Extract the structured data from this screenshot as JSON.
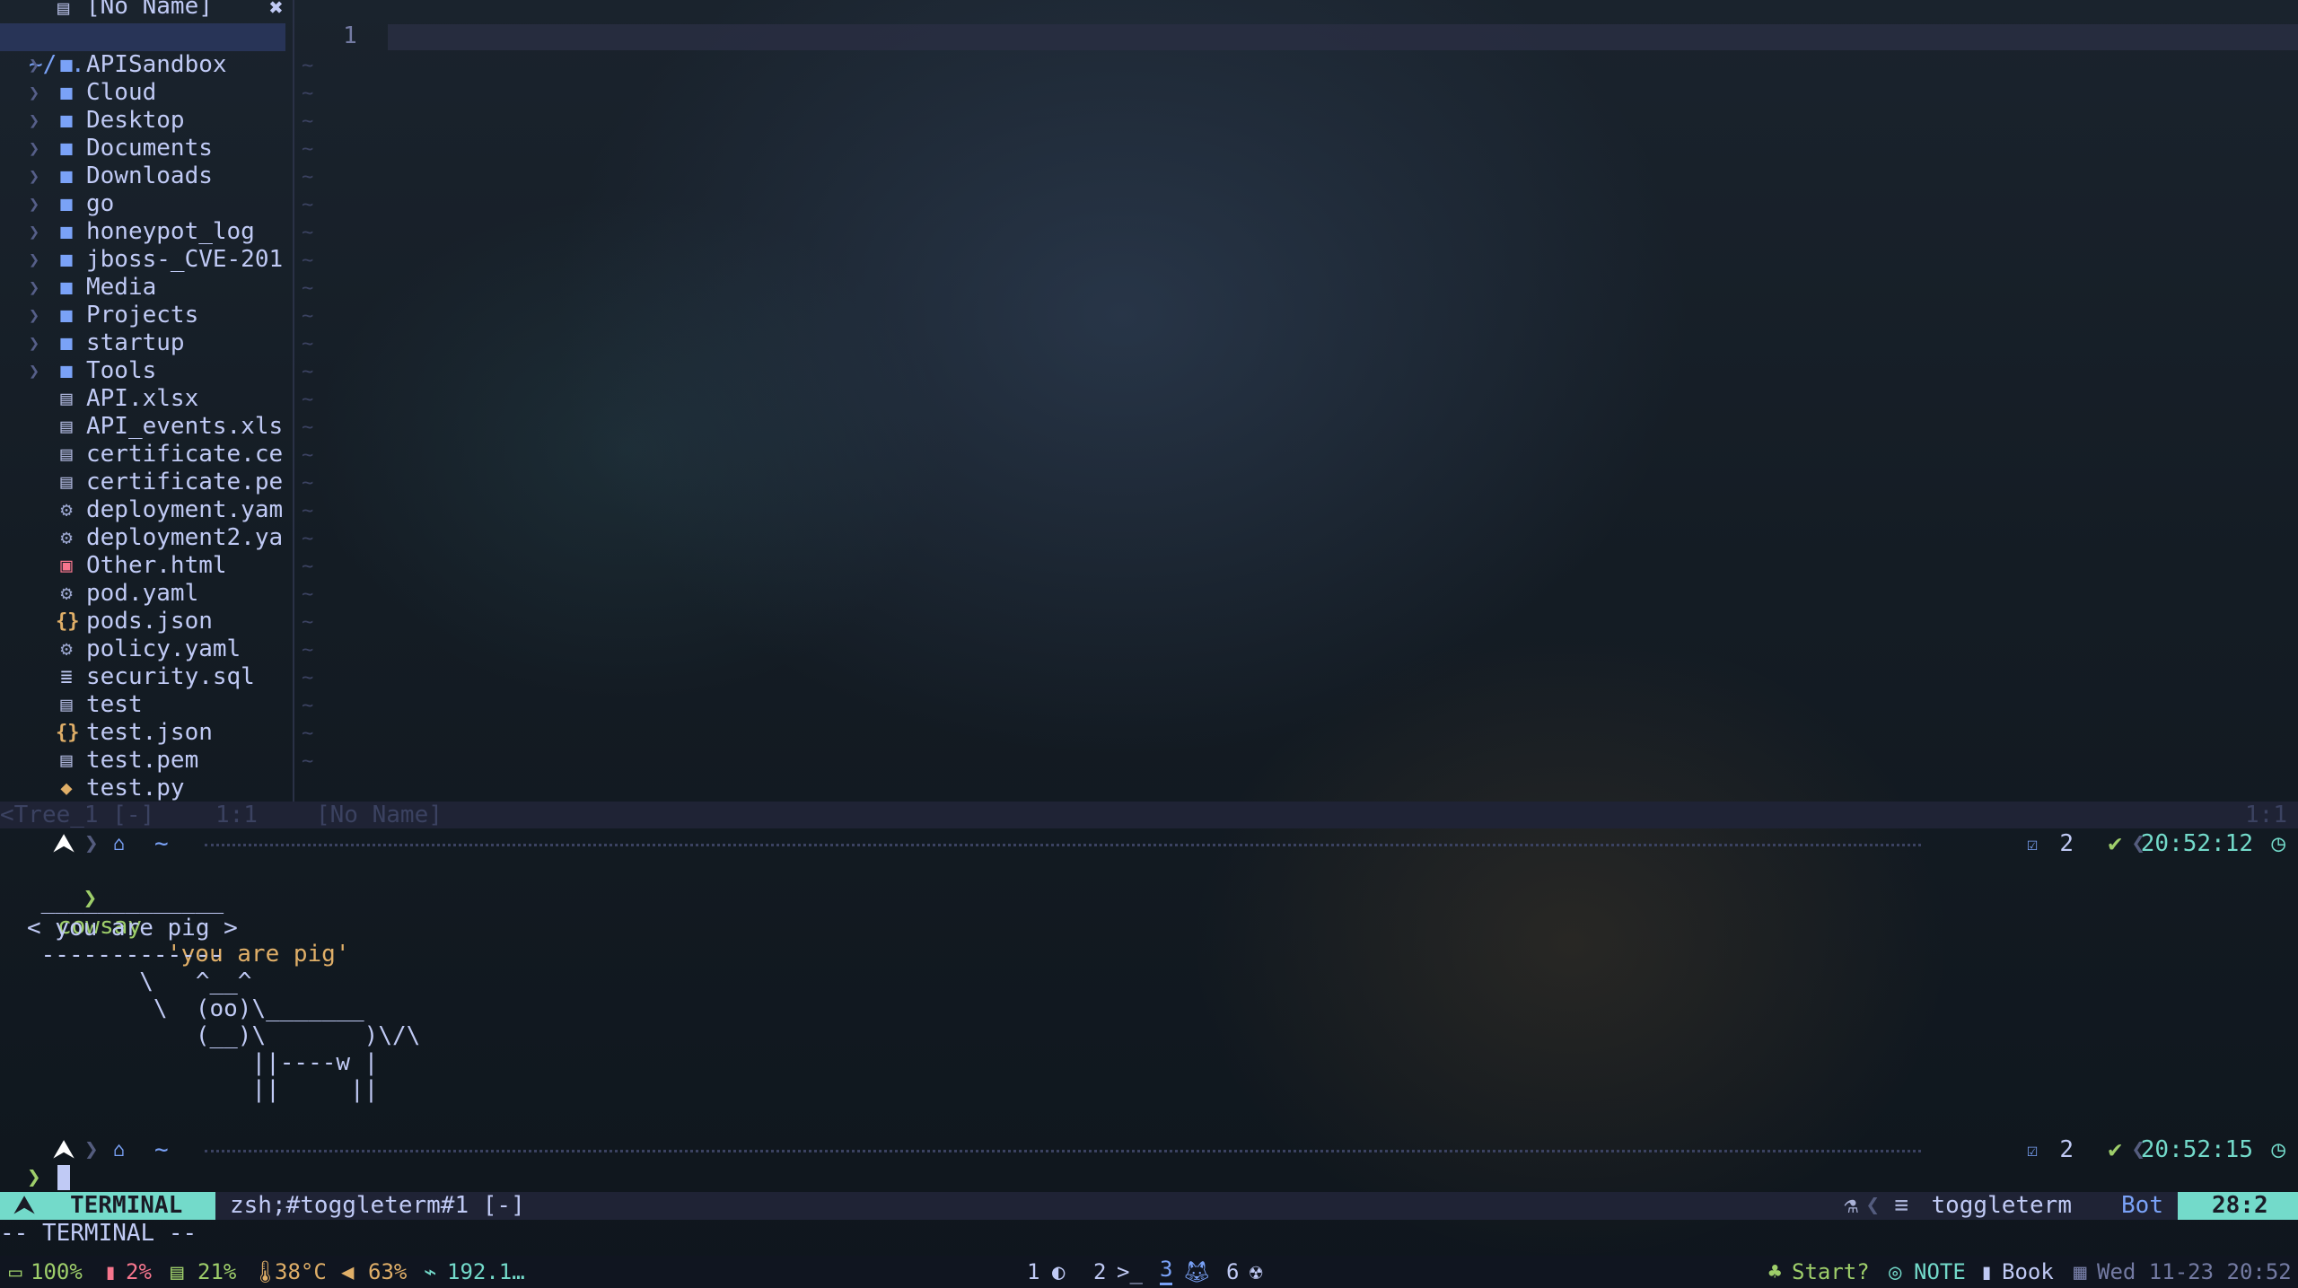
{
  "buffer_tab": {
    "name": "[No Name]",
    "close_icon": "✖"
  },
  "tree": {
    "root": "~/..",
    "items": [
      {
        "name": "APISandbox",
        "type": "folder"
      },
      {
        "name": "Cloud",
        "type": "folder"
      },
      {
        "name": "Desktop",
        "type": "folder"
      },
      {
        "name": "Documents",
        "type": "folder"
      },
      {
        "name": "Downloads",
        "type": "folder"
      },
      {
        "name": "go",
        "type": "folder"
      },
      {
        "name": "honeypot_log",
        "type": "folder"
      },
      {
        "name": "jboss-_CVE-201",
        "type": "folder"
      },
      {
        "name": "Media",
        "type": "folder"
      },
      {
        "name": "Projects",
        "type": "folder"
      },
      {
        "name": "startup",
        "type": "folder"
      },
      {
        "name": "Tools",
        "type": "folder"
      },
      {
        "name": "API.xlsx",
        "type": "file"
      },
      {
        "name": "API_events.xls",
        "type": "file"
      },
      {
        "name": "certificate.ce",
        "type": "file"
      },
      {
        "name": "certificate.pe",
        "type": "file"
      },
      {
        "name": "deployment.yam",
        "type": "gear"
      },
      {
        "name": "deployment2.ya",
        "type": "gear"
      },
      {
        "name": "Other.html",
        "type": "html"
      },
      {
        "name": "pod.yaml",
        "type": "gear"
      },
      {
        "name": "pods.json",
        "type": "json"
      },
      {
        "name": "policy.yaml",
        "type": "gear"
      },
      {
        "name": "security.sql",
        "type": "db"
      },
      {
        "name": "test",
        "type": "file"
      },
      {
        "name": "test.json",
        "type": "json"
      },
      {
        "name": "test.pem",
        "type": "file"
      },
      {
        "name": "test.py",
        "type": "py"
      }
    ]
  },
  "editor": {
    "line_number": "1"
  },
  "split_status": {
    "left": "<Tree_1 [-]",
    "pos": "1:1",
    "buffer": "[No Name]",
    "right": "1:1"
  },
  "prompt1": {
    "arch": "⮝",
    "home": "~",
    "count": "2",
    "time": "20:52:12"
  },
  "prompt2": {
    "arch": "⮝",
    "home": "~",
    "count": "2",
    "time": "20:52:15"
  },
  "command": {
    "prompt": "❯",
    "cmd": "cowsay",
    "arg": "'you are pig'"
  },
  "cow_lines": [
    " _____________",
    "< you are pig >",
    " -------------",
    "        \\   ^__^",
    "         \\  (oo)\\_______",
    "            (__)\\       )\\/\\",
    "                ||----w |",
    "                ||     ||"
  ],
  "input_prompt": "❯",
  "term_status": {
    "mode": "TERMINAL",
    "title": "zsh;#toggleterm#1 [-]",
    "ft": "toggleterm",
    "position": "Bot",
    "cursor": "28:2"
  },
  "mode_line": "-- TERMINAL --",
  "sysbar": {
    "battery": "100%",
    "cpu": "2%",
    "mem": "21%",
    "temp": "38°C",
    "volume": "63%",
    "ip": "192.1…",
    "workspaces": [
      "1",
      "2",
      "3",
      "6"
    ],
    "start": "Start?",
    "note": "NOTE",
    "book": "Book",
    "datetime": "Wed 11-23 20:52"
  },
  "colors": {
    "accent_blue": "#7aa2f7",
    "accent_green": "#9ece6a",
    "accent_teal": "#73daca",
    "accent_yellow": "#e0af68",
    "accent_red": "#f7768e",
    "statusline_bg": "#1f2335"
  }
}
